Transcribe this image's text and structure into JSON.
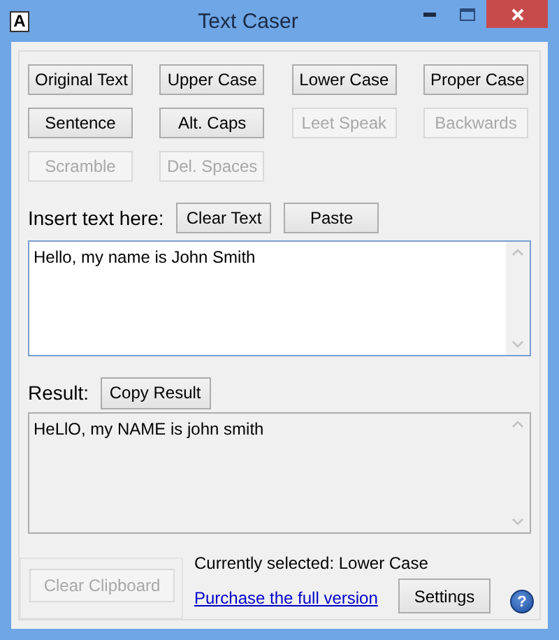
{
  "window": {
    "title": "Text Caser",
    "app_icon": "A"
  },
  "mode_buttons": [
    {
      "label": "Original Text",
      "disabled": false
    },
    {
      "label": "Upper Case",
      "disabled": false
    },
    {
      "label": "Lower Case",
      "disabled": false
    },
    {
      "label": "Proper Case",
      "disabled": false
    },
    {
      "label": "Sentence",
      "disabled": false
    },
    {
      "label": "Alt. Caps",
      "disabled": false
    },
    {
      "label": "Leet Speak",
      "disabled": true
    },
    {
      "label": "Backwards",
      "disabled": true
    },
    {
      "label": "Scramble",
      "disabled": true
    },
    {
      "label": "Del. Spaces",
      "disabled": true
    }
  ],
  "input": {
    "label": "Insert text here:",
    "buttons": [
      "Clear Text",
      "Paste"
    ],
    "value": "Hello, my name is John Smith"
  },
  "result": {
    "label": "Result:",
    "button": "Copy Result",
    "value": "HeLlO, my NAME is john smith"
  },
  "clear_clipboard": {
    "label": "Clear Clipboard",
    "disabled": true
  },
  "status": "Currently selected: Lower Case",
  "purchase_link": "Purchase the full version",
  "settings_button": "Settings",
  "help_icon": "?"
}
